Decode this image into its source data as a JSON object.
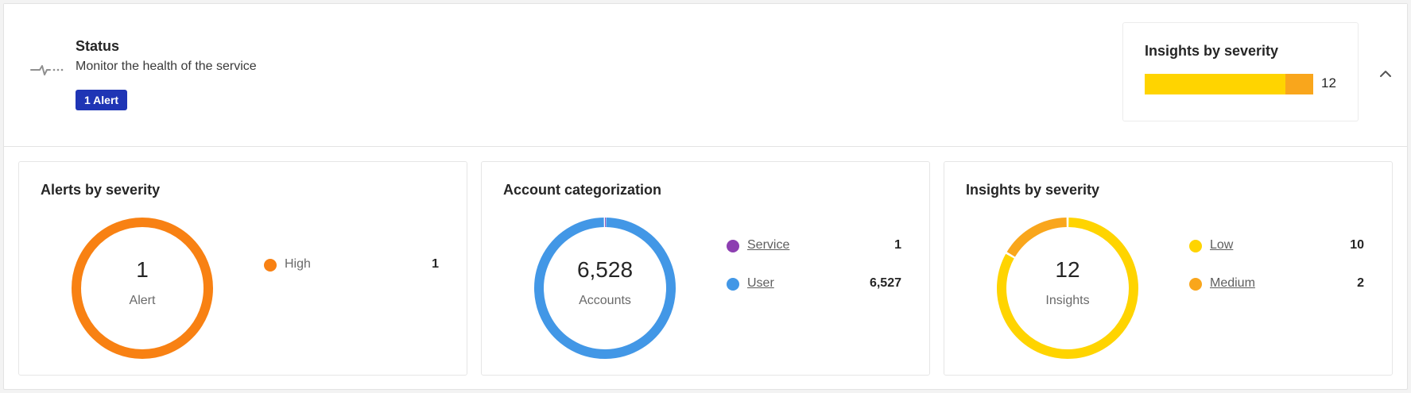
{
  "status": {
    "title": "Status",
    "subtitle": "Monitor the health of the service",
    "badge": "1 Alert",
    "icon": "activity-pulse-icon"
  },
  "header_insights": {
    "title": "Insights by severity",
    "total": "12",
    "segments": [
      {
        "name": "Low",
        "value": 10,
        "color": "#ffd400"
      },
      {
        "name": "Medium",
        "value": 2,
        "color": "#f9a61c"
      }
    ]
  },
  "collapse_icon": "chevron-up-icon",
  "cards": [
    {
      "title": "Alerts by severity",
      "center_value": "1",
      "center_label": "Alert",
      "legend": [
        {
          "label": "High",
          "value": "1",
          "color": "#f88113",
          "link": false
        }
      ]
    },
    {
      "title": "Account categorization",
      "center_value": "6,528",
      "center_label": "Accounts",
      "legend": [
        {
          "label": "Service",
          "value": "1",
          "color": "#8d3fb1",
          "link": true
        },
        {
          "label": "User",
          "value": "6,527",
          "color": "#4297e6",
          "link": true
        }
      ]
    },
    {
      "title": "Insights by severity",
      "center_value": "12",
      "center_label": "Insights",
      "legend": [
        {
          "label": "Low",
          "value": "10",
          "color": "#ffd400",
          "link": true
        },
        {
          "label": "Medium",
          "value": "2",
          "color": "#f9a61c",
          "link": true
        }
      ]
    }
  ],
  "chart_data": [
    {
      "type": "pie",
      "title": "Alerts by severity",
      "categories": [
        "High"
      ],
      "values": [
        1
      ],
      "colors": [
        "#f88113"
      ]
    },
    {
      "type": "pie",
      "title": "Account categorization",
      "categories": [
        "Service",
        "User"
      ],
      "values": [
        1,
        6527
      ],
      "colors": [
        "#8d3fb1",
        "#4297e6"
      ]
    },
    {
      "type": "pie",
      "title": "Insights by severity",
      "categories": [
        "Low",
        "Medium"
      ],
      "values": [
        10,
        2
      ],
      "colors": [
        "#ffd400",
        "#f9a61c"
      ]
    }
  ]
}
